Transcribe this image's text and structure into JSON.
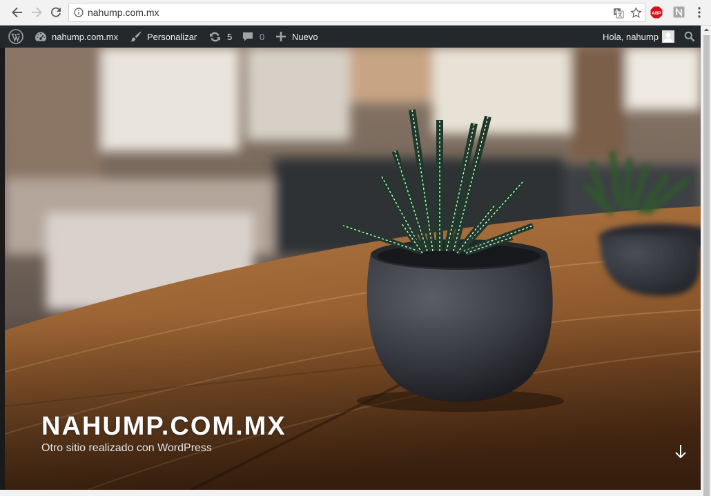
{
  "browser": {
    "url": "nahump.com.mx"
  },
  "adminbar": {
    "site_name": "nahump.com.mx",
    "customize_label": "Personalizar",
    "updates_count": "5",
    "comments_count": "0",
    "new_label": "Nuevo",
    "greeting": "Hola, nahump"
  },
  "hero": {
    "title": "NAHUMP.COM.MX",
    "description": "Otro sitio realizado con WordPress"
  },
  "colors": {
    "adminbar_bg": "#23282d",
    "browser_bar_bg": "#f2f2f2"
  }
}
